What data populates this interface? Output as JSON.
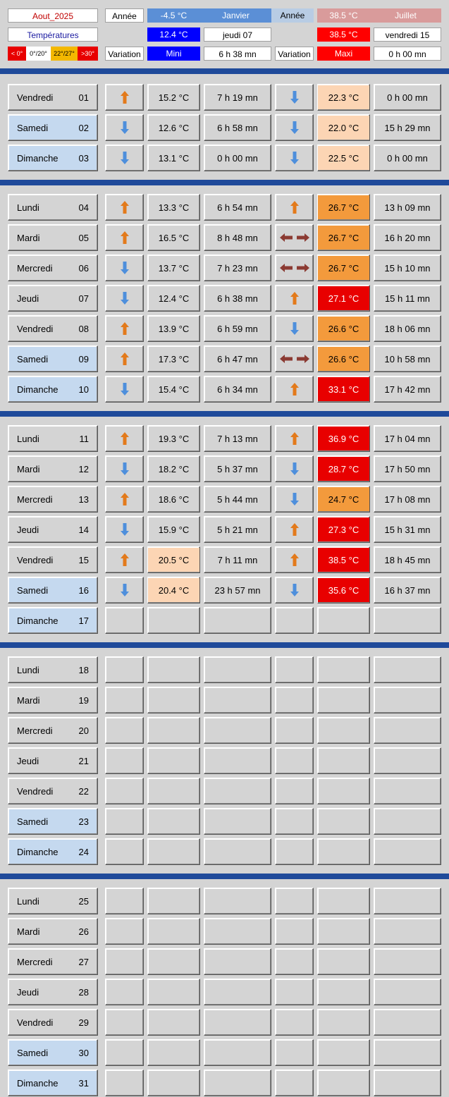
{
  "colors": {
    "hot": "#e80000",
    "warm": "#f39a3c",
    "mild": "#fcd5b4",
    "blue": "#0000ff",
    "redcell": "#ff0000",
    "yearblue": "#5b8fd6",
    "yearred": "#d99b9b",
    "weekend": "#c5d9ef",
    "sep": "#1f4a9a",
    "arrowUp": "#e37a1b",
    "arrowDown": "#4e8fdc",
    "arrowSame": "#8b3a32"
  },
  "header": {
    "month": "Aout_2025",
    "annee_label_1": "Année",
    "year_min_value": "-4.5 °C",
    "year_min_month": "Janvier",
    "annee_label_2": "Année",
    "year_max_value": "38.5 °C",
    "year_max_month": "Juillet",
    "temperatures_label": "Températures",
    "month_min_value": "12.4 °C",
    "month_min_date": "jeudi 07",
    "month_max_value": "38.5 °C",
    "month_max_date": "vendredi 15",
    "legend": [
      "< 0°",
      "0°/20°",
      "22°/27°",
      ">30°"
    ],
    "variation_label_1": "Variation",
    "mini_label": "Mini",
    "mini_time": "6 h 38 mn",
    "variation_label_2": "Variation",
    "maxi_label": "Maxi",
    "maxi_time": "0 h 00 mn"
  },
  "days": [
    {
      "name": "Vendredi",
      "num": "01",
      "we": false,
      "v1": "up",
      "min": "15.2 °C",
      "minbg": "",
      "t1": "7 h 19 mn",
      "v2": "down",
      "max": "22.3 °C",
      "maxbg": "mild",
      "t2": "0 h 00 mn"
    },
    {
      "name": "Samedi",
      "num": "02",
      "we": true,
      "v1": "down",
      "min": "12.6 °C",
      "minbg": "",
      "t1": "6 h 58 mn",
      "v2": "down",
      "max": "22.0 °C",
      "maxbg": "mild",
      "t2": "15 h 29 mn"
    },
    {
      "name": "Dimanche",
      "num": "03",
      "we": true,
      "v1": "down",
      "min": "13.1 °C",
      "minbg": "",
      "t1": "0 h 00 mn",
      "v2": "down",
      "max": "22.5 °C",
      "maxbg": "mild",
      "t2": "0 h 00 mn"
    },
    {
      "name": "Lundi",
      "num": "04",
      "we": false,
      "v1": "up",
      "min": "13.3 °C",
      "minbg": "",
      "t1": "6 h 54 mn",
      "v2": "up",
      "max": "26.7 °C",
      "maxbg": "warm",
      "t2": "13 h 09 mn"
    },
    {
      "name": "Mardi",
      "num": "05",
      "we": false,
      "v1": "up",
      "min": "16.5 °C",
      "minbg": "",
      "t1": "8 h 48 mn",
      "v2": "same",
      "max": "26.7 °C",
      "maxbg": "warm",
      "t2": "16 h 20 mn"
    },
    {
      "name": "Mercredi",
      "num": "06",
      "we": false,
      "v1": "down",
      "min": "13.7 °C",
      "minbg": "",
      "t1": "7 h 23 mn",
      "v2": "same",
      "max": "26.7 °C",
      "maxbg": "warm",
      "t2": "15 h 10 mn"
    },
    {
      "name": "Jeudi",
      "num": "07",
      "we": false,
      "v1": "down",
      "min": "12.4 °C",
      "minbg": "",
      "t1": "6 h 38 mn",
      "v2": "up",
      "max": "27.1 °C",
      "maxbg": "hot",
      "t2": "15 h 11 mn"
    },
    {
      "name": "Vendredi",
      "num": "08",
      "we": false,
      "v1": "up",
      "min": "13.9 °C",
      "minbg": "",
      "t1": "6 h 59 mn",
      "v2": "down",
      "max": "26.6 °C",
      "maxbg": "warm",
      "t2": "18 h 06 mn"
    },
    {
      "name": "Samedi",
      "num": "09",
      "we": true,
      "v1": "up",
      "min": "17.3 °C",
      "minbg": "",
      "t1": "6 h 47 mn",
      "v2": "same",
      "max": "26.6 °C",
      "maxbg": "warm",
      "t2": "10 h 58 mn"
    },
    {
      "name": "Dimanche",
      "num": "10",
      "we": true,
      "v1": "down",
      "min": "15.4 °C",
      "minbg": "",
      "t1": "6 h 34 mn",
      "v2": "up",
      "max": "33.1 °C",
      "maxbg": "hot",
      "t2": "17 h 42 mn"
    },
    {
      "name": "Lundi",
      "num": "11",
      "we": false,
      "v1": "up",
      "min": "19.3 °C",
      "minbg": "",
      "t1": "7 h 13 mn",
      "v2": "up",
      "max": "36.9 °C",
      "maxbg": "hot",
      "t2": "17 h 04 mn"
    },
    {
      "name": "Mardi",
      "num": "12",
      "we": false,
      "v1": "down",
      "min": "18.2 °C",
      "minbg": "",
      "t1": "5 h 37 mn",
      "v2": "down",
      "max": "28.7 °C",
      "maxbg": "hot",
      "t2": "17 h 50 mn"
    },
    {
      "name": "Mercredi",
      "num": "13",
      "we": false,
      "v1": "up",
      "min": "18.6 °C",
      "minbg": "",
      "t1": "5 h 44 mn",
      "v2": "down",
      "max": "24.7 °C",
      "maxbg": "warm",
      "t2": "17 h 08 mn"
    },
    {
      "name": "Jeudi",
      "num": "14",
      "we": false,
      "v1": "down",
      "min": "15.9 °C",
      "minbg": "",
      "t1": "5 h 21 mn",
      "v2": "up",
      "max": "27.3 °C",
      "maxbg": "hot",
      "t2": "15 h 31 mn"
    },
    {
      "name": "Vendredi",
      "num": "15",
      "we": false,
      "v1": "up",
      "min": "20.5 °C",
      "minbg": "mild",
      "t1": "7 h 11 mn",
      "v2": "up",
      "max": "38.5 °C",
      "maxbg": "hot",
      "t2": "18 h 45 mn"
    },
    {
      "name": "Samedi",
      "num": "16",
      "we": true,
      "v1": "down",
      "min": "20.4 °C",
      "minbg": "mild",
      "t1": "23 h 57 mn",
      "v2": "down",
      "max": "35.6 °C",
      "maxbg": "hot",
      "t2": "16 h 37 mn"
    },
    {
      "name": "Dimanche",
      "num": "17",
      "we": true
    },
    {
      "name": "Lundi",
      "num": "18",
      "we": false
    },
    {
      "name": "Mardi",
      "num": "19",
      "we": false
    },
    {
      "name": "Mercredi",
      "num": "20",
      "we": false
    },
    {
      "name": "Jeudi",
      "num": "21",
      "we": false
    },
    {
      "name": "Vendredi",
      "num": "22",
      "we": false
    },
    {
      "name": "Samedi",
      "num": "23",
      "we": true
    },
    {
      "name": "Dimanche",
      "num": "24",
      "we": true
    },
    {
      "name": "Lundi",
      "num": "25",
      "we": false
    },
    {
      "name": "Mardi",
      "num": "26",
      "we": false
    },
    {
      "name": "Mercredi",
      "num": "27",
      "we": false
    },
    {
      "name": "Jeudi",
      "num": "28",
      "we": false
    },
    {
      "name": "Vendredi",
      "num": "29",
      "we": false
    },
    {
      "name": "Samedi",
      "num": "30",
      "we": true
    },
    {
      "name": "Dimanche",
      "num": "31",
      "we": true
    }
  ]
}
